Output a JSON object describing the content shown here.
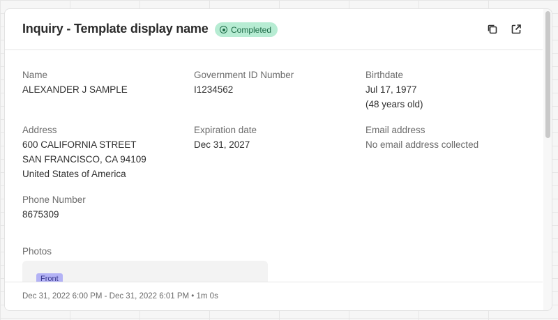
{
  "header": {
    "title": "Inquiry - Template display name",
    "status": "Completed",
    "status_color": "#b7ecd3",
    "actions": [
      {
        "name": "copy",
        "icon": "copy-icon"
      },
      {
        "name": "open",
        "icon": "external-link-icon"
      }
    ]
  },
  "fields": {
    "name": {
      "label": "Name",
      "value": "ALEXANDER J SAMPLE"
    },
    "government_id": {
      "label": "Government ID Number",
      "value": "I1234562"
    },
    "birthdate": {
      "label": "Birthdate",
      "value": "Jul 17, 1977",
      "age": "(48 years old)"
    },
    "address": {
      "label": "Address",
      "line1": "600 CALIFORNIA STREET",
      "line2": "SAN FRANCISCO, CA 94109",
      "line3": "United States of America"
    },
    "expiration_date": {
      "label": "Expiration date",
      "value": "Dec 31, 2027"
    },
    "email": {
      "label": "Email address",
      "value": "No email address collected"
    },
    "phone": {
      "label": "Phone Number",
      "value": "8675309"
    }
  },
  "photos": {
    "label": "Photos",
    "front_tag": "Front",
    "tag_color": "#b3b2f5"
  },
  "footer": {
    "timing": "Dec 31, 2022 6:00 PM - Dec 31, 2022 6:01 PM • 1m 0s"
  }
}
